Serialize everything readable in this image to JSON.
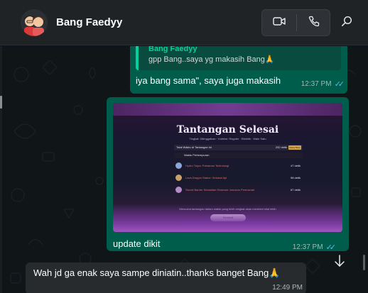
{
  "header": {
    "contact_name": "Bang Faedyy",
    "icons": [
      "video-call-icon",
      "voice-call-icon",
      "search-icon"
    ]
  },
  "messages": [
    {
      "direction": "outgoing",
      "quote_author": "Bang Faedyy",
      "quote_text": "gpp Bang..saya yg makasih Bang🙏",
      "text": "iya bang sama\", saya juga makasih",
      "time": "12:37 PM",
      "status": "read"
    },
    {
      "direction": "outgoing",
      "type": "image",
      "image": {
        "title": "Tantangan Selesai",
        "subtitle": "Tingkat: Ditinggalkan · Koleksi: Reguler · Elektrik · Main Satu",
        "total_label": "Total Waktu di Tantangan Ini",
        "total_value": "232 detik",
        "total_tag": "Rekor Baru",
        "section_label": "Waktu Pertempuran",
        "items": [
          {
            "name": "Hydro Tulpa: Pahaman Terlindungi",
            "value": "47 detik"
          },
          {
            "name": "Lava Dragon Statue: Sekarat Api",
            "value": "98 detik"
          },
          {
            "name": "Sword Barrier Sebastian Khaimon: Amukan Pemusnah",
            "value": "87 detik"
          }
        ],
        "footer": "Mencoba tantangan dalam waktu yang lebih singkat akan memberi nilai lebih",
        "button": "Kembali"
      },
      "text": "update dikit",
      "time": "12:37 PM",
      "status": "read"
    },
    {
      "direction": "incoming",
      "text": "Wah jd ga enak saya sampe diniatin..thanks banget Bang🙏",
      "time": "12:49 PM"
    }
  ],
  "colors": {
    "outgoing_bubble": "#005c4b",
    "incoming_bubble": "#272b2e",
    "read_check": "#53bdeb",
    "quote_accent": "#06cf9c"
  }
}
